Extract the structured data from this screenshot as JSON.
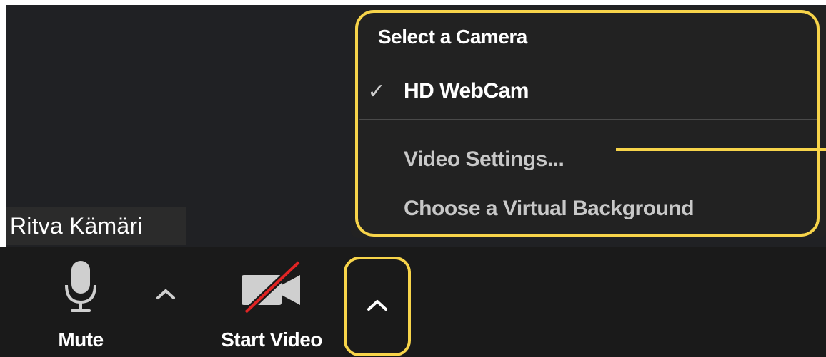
{
  "participant": {
    "name": "Ritva Kämäri"
  },
  "toolbar": {
    "mute_label": "Mute",
    "start_video_label": "Start Video"
  },
  "camera_menu": {
    "header": "Select a Camera",
    "cameras": [
      {
        "label": "HD WebCam",
        "selected": true
      }
    ],
    "actions": [
      {
        "label": "Video Settings..."
      },
      {
        "label": "Choose a Virtual Background"
      }
    ]
  },
  "colors": {
    "highlight": "#f7d44a",
    "video_off_slash": "#e02424",
    "toolbar_bg": "#1a1a1a",
    "video_bg": "#202124",
    "menu_bg": "#222222"
  },
  "icons": {
    "mute": "microphone-icon",
    "video": "video-camera-off-icon",
    "caret": "chevron-up-icon",
    "check": "checkmark-icon"
  }
}
